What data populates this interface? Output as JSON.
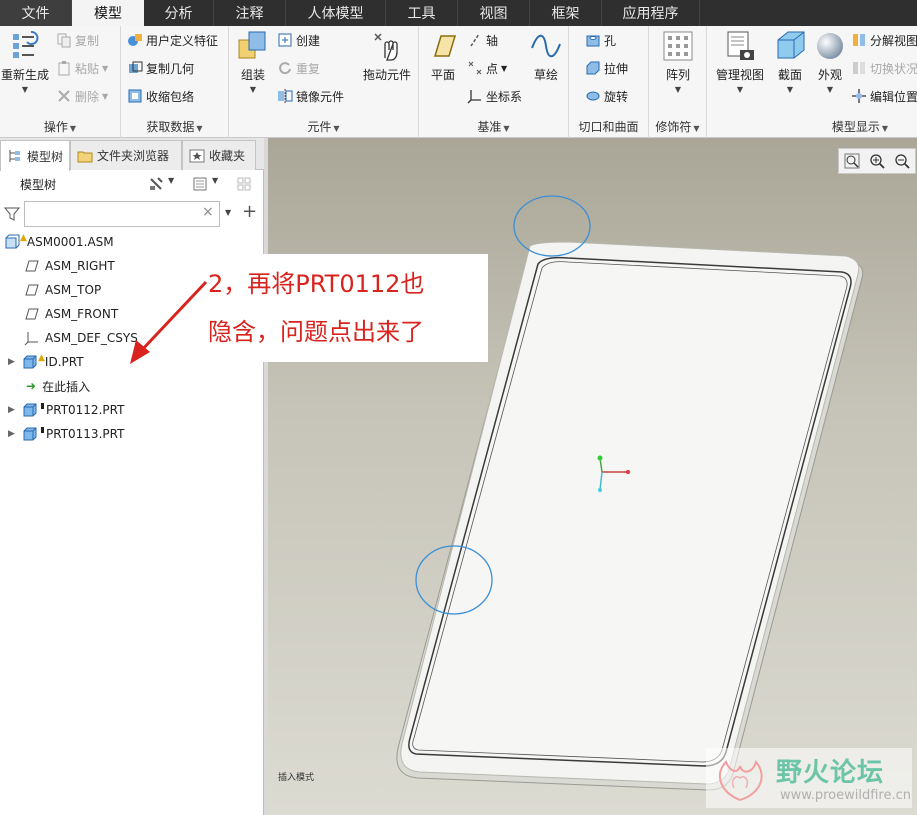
{
  "menu": {
    "tabs": [
      {
        "label": "文件"
      },
      {
        "label": "模型"
      },
      {
        "label": "分析"
      },
      {
        "label": "注释"
      },
      {
        "label": "人体模型"
      },
      {
        "label": "工具"
      },
      {
        "label": "视图"
      },
      {
        "label": "框架"
      },
      {
        "label": "应用程序"
      }
    ],
    "active_tab": "模型"
  },
  "ribbon": {
    "operations": {
      "label": "操作",
      "regenerate": "重新生成",
      "copy": "复制",
      "paste": "粘贴",
      "delete": "删除"
    },
    "get_data": {
      "label": "获取数据",
      "user_feature": "用户定义特征",
      "copy_geometry": "复制几何",
      "shrinkwrap": "收缩包络"
    },
    "component": {
      "label": "元件",
      "assemble": "组装",
      "create": "创建",
      "repeat": "重复",
      "mirror": "镜像元件",
      "drag": "拖动元件"
    },
    "datum": {
      "label": "基准",
      "plane": "平面",
      "axis": "轴",
      "point": "点",
      "csys": "坐标系",
      "sketch": "草绘"
    },
    "cut_surface": {
      "label": "切口和曲面",
      "hole": "孔",
      "extrude": "拉伸",
      "revolve": "旋转"
    },
    "modifiers": {
      "label": "修饰符",
      "pattern": "阵列"
    },
    "model_display": {
      "label": "模型显示",
      "manage_views": "管理视图",
      "section": "截面",
      "appearance": "外观",
      "explode_view": "分解视图",
      "toggle_state": "切换状况",
      "edit_position": "编辑位置"
    }
  },
  "panel": {
    "tabs": [
      {
        "label": "模型树"
      },
      {
        "label": "文件夹浏览器"
      },
      {
        "label": "收藏夹"
      }
    ],
    "tree_header": "模型树",
    "filter_placeholder": "",
    "clear_symbol": "×",
    "add_symbol": "+"
  },
  "tree": {
    "items": [
      {
        "label": "ASM0001.ASM"
      },
      {
        "label": "ASM_RIGHT"
      },
      {
        "label": "ASM_TOP"
      },
      {
        "label": "ASM_FRONT"
      },
      {
        "label": "ASM_DEF_CSYS"
      },
      {
        "label": "ID.PRT"
      },
      {
        "label": "在此插入"
      },
      {
        "label": "PRT0112.PRT"
      },
      {
        "label": "PRT0113.PRT"
      }
    ]
  },
  "annotation": {
    "line1": "2，再将PRT0112也",
    "line2": "隐含，问题点出来了",
    "color": "#d9231e"
  },
  "viewport": {
    "status_text": "插入模式"
  },
  "watermark": {
    "title": "野火论坛",
    "url": "www.proewildfire.cn"
  }
}
